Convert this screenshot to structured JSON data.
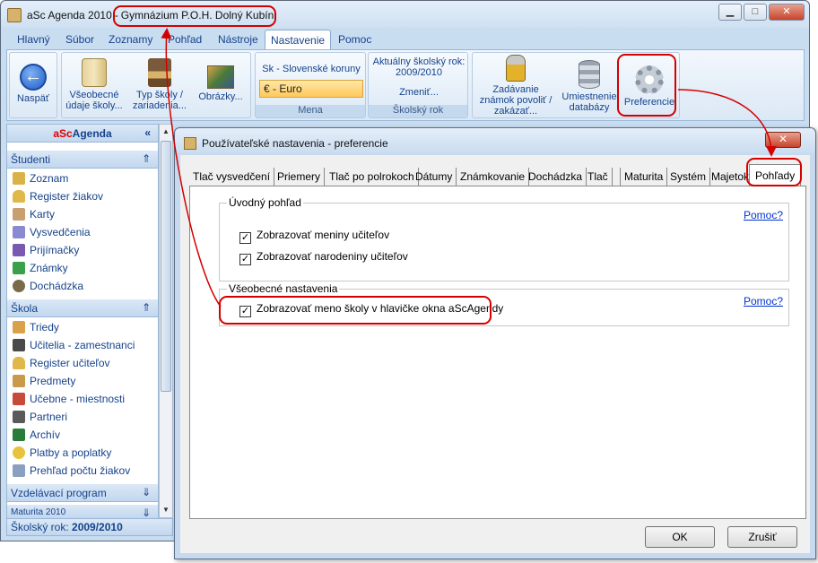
{
  "window": {
    "app_name": "aSc Agenda 2010",
    "title_separator": "-",
    "school_name": "Gymnázium P.O.H. Dolný Kubín",
    "minimize": "▁",
    "maximize": "□",
    "close": "✕"
  },
  "menu": {
    "items": [
      "Hlavný",
      "Súbor",
      "Zoznamy",
      "Pohľad",
      "Nástroje",
      "Nastavenie",
      "Pomoc"
    ],
    "active": "Nastavenie"
  },
  "ribbon": {
    "back": {
      "label": "Naspäť",
      "icon": "back-arrow-icon"
    },
    "general": {
      "label": "Všeobecné údaje školy...",
      "icon": "scroll-icon"
    },
    "school_type": {
      "label": "Typ školy / zariadenia...",
      "icon": "stamp-icon"
    },
    "images": {
      "label": "Obrázky...",
      "icon": "pictures-icon"
    },
    "currency": {
      "label": "Sk - Slovenské koruny",
      "selected": "€ - Euro",
      "group": "Mena"
    },
    "school_year": {
      "label": "Aktuálny školský rok: 2009/2010",
      "change": "Zmeniť...",
      "group": "Školský rok"
    },
    "grades": {
      "label": "Zadávanie známok povoliť / zakázať...",
      "icon": "lock-icon"
    },
    "database": {
      "label": "Umiestnenie databázy",
      "icon": "database-icon"
    },
    "preferences": {
      "label": "Preferencie",
      "icon": "gear-icon"
    }
  },
  "sidebar": {
    "brand_red": "aSc",
    "brand_rest": "Agenda",
    "brand_chev": "«",
    "sections": [
      {
        "title": "Študenti",
        "chev": "⇑",
        "items": [
          "Zoznam",
          "Register žiakov",
          "Karty",
          "Vysvedčenia",
          "Prijímačky",
          "Známky",
          "Dochádzka"
        ]
      },
      {
        "title": "Škola",
        "chev": "⇑",
        "items": [
          "Triedy",
          "Učitelia - zamestnanci",
          "Register učiteľov",
          "Predmety",
          "Učebne - miestnosti",
          "Partneri",
          "Archív",
          "Platby a poplatky",
          "Prehľad počtu žiakov"
        ]
      },
      {
        "title": "Vzdelávací program",
        "chev": "⇓"
      },
      {
        "title": "Maturita 2010",
        "chev": "⇓"
      }
    ]
  },
  "status": {
    "label": "Školský rok:",
    "value": "2009/2010"
  },
  "dialog": {
    "title": "Používateľské nastavenia - preferencie",
    "close": "✕",
    "tabs": [
      "Tlač vysvedčení",
      "Priemery",
      "Tlač po polrokoch",
      "Dátumy",
      "Známkovanie",
      "Dochádzka",
      "Tlač",
      "Maturita",
      "Systém",
      "Majetok",
      "Pohľady"
    ],
    "active_tab": "Pohľady",
    "groups": [
      {
        "legend": "Úvodný pohľad",
        "help": "Pomoc?",
        "options": [
          {
            "label": "Zobrazovať meniny učiteľov",
            "checked": true
          },
          {
            "label": "Zobrazovať narodeniny učiteľov",
            "checked": true
          }
        ]
      },
      {
        "legend": "Všeobecné nastavenia",
        "help": "Pomoc?",
        "options": [
          {
            "label": "Zobrazovať meno školy v hlavičke okna aScAgendy",
            "checked": true
          }
        ]
      }
    ],
    "check_mark": "✓",
    "ok": "OK",
    "cancel": "Zrušiť"
  },
  "colors": {
    "annotation": "#d40000",
    "accent": "#15428b",
    "currency_highlight": "#ffc75a"
  }
}
